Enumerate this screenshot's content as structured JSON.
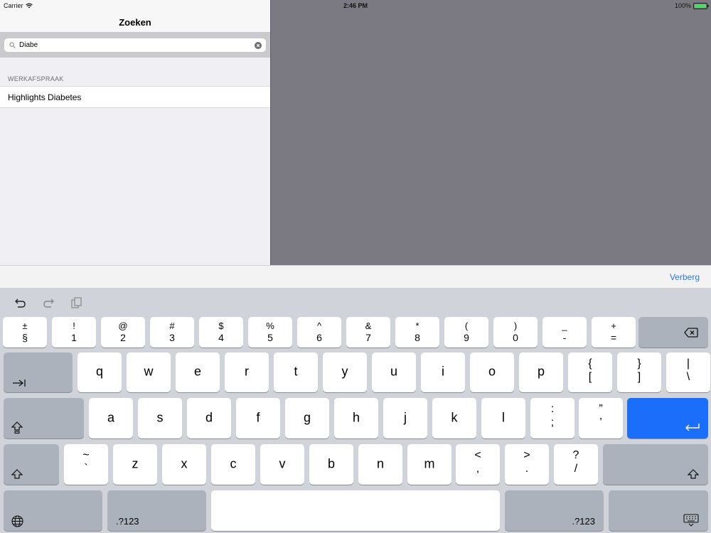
{
  "status_bar": {
    "carrier": "Carrier",
    "time": "2:46 PM",
    "battery": "100%",
    "battery_level": 1.0
  },
  "nav": {
    "title": "Zoeken"
  },
  "search": {
    "value": "Diabe"
  },
  "results": {
    "section_header": "WERKAFSPRAAK",
    "items": [
      {
        "label": "Highlights Diabetes"
      }
    ]
  },
  "accessory": {
    "hide_label": "Verberg"
  },
  "keyboard": {
    "number_row": [
      {
        "top": "±",
        "bottom": "§"
      },
      {
        "top": "!",
        "bottom": "1"
      },
      {
        "top": "@",
        "bottom": "2"
      },
      {
        "top": "#",
        "bottom": "3"
      },
      {
        "top": "$",
        "bottom": "4"
      },
      {
        "top": "%",
        "bottom": "5"
      },
      {
        "top": "^",
        "bottom": "6"
      },
      {
        "top": "&",
        "bottom": "7"
      },
      {
        "top": "*",
        "bottom": "8"
      },
      {
        "top": "(",
        "bottom": "9"
      },
      {
        "top": ")",
        "bottom": "0"
      },
      {
        "top": "_",
        "bottom": "-"
      },
      {
        "top": "+",
        "bottom": "="
      }
    ],
    "row_q": [
      "q",
      "w",
      "e",
      "r",
      "t",
      "y",
      "u",
      "i",
      "o",
      "p"
    ],
    "row_q_extra": [
      {
        "top": "{",
        "bottom": "["
      },
      {
        "top": "}",
        "bottom": "]"
      },
      {
        "top": "|",
        "bottom": "\\"
      }
    ],
    "row_a": [
      "a",
      "s",
      "d",
      "f",
      "g",
      "h",
      "j",
      "k",
      "l"
    ],
    "row_a_extra": [
      {
        "top": ":",
        "bottom": ";"
      },
      {
        "top": "”",
        "bottom": "’"
      }
    ],
    "row_z_first": {
      "top": "~",
      "bottom": "`"
    },
    "row_z": [
      "z",
      "x",
      "c",
      "v",
      "b",
      "n",
      "m"
    ],
    "row_z_extra": [
      {
        "top": "<",
        "bottom": ","
      },
      {
        "top": ">",
        "bottom": "."
      },
      {
        "top": "?",
        "bottom": "/"
      }
    ],
    "numbers_label": ".?123",
    "icons": {
      "undo": "undo-icon",
      "redo": "redo-icon",
      "paste": "paste-icon",
      "delete": "backspace-icon",
      "tab": "tab-icon",
      "caps": "caps-lock-icon",
      "return": "return-icon",
      "shift": "shift-icon",
      "globe": "globe-icon",
      "dismiss": "keyboard-dismiss-icon"
    },
    "return_color": "#1b6efa"
  }
}
